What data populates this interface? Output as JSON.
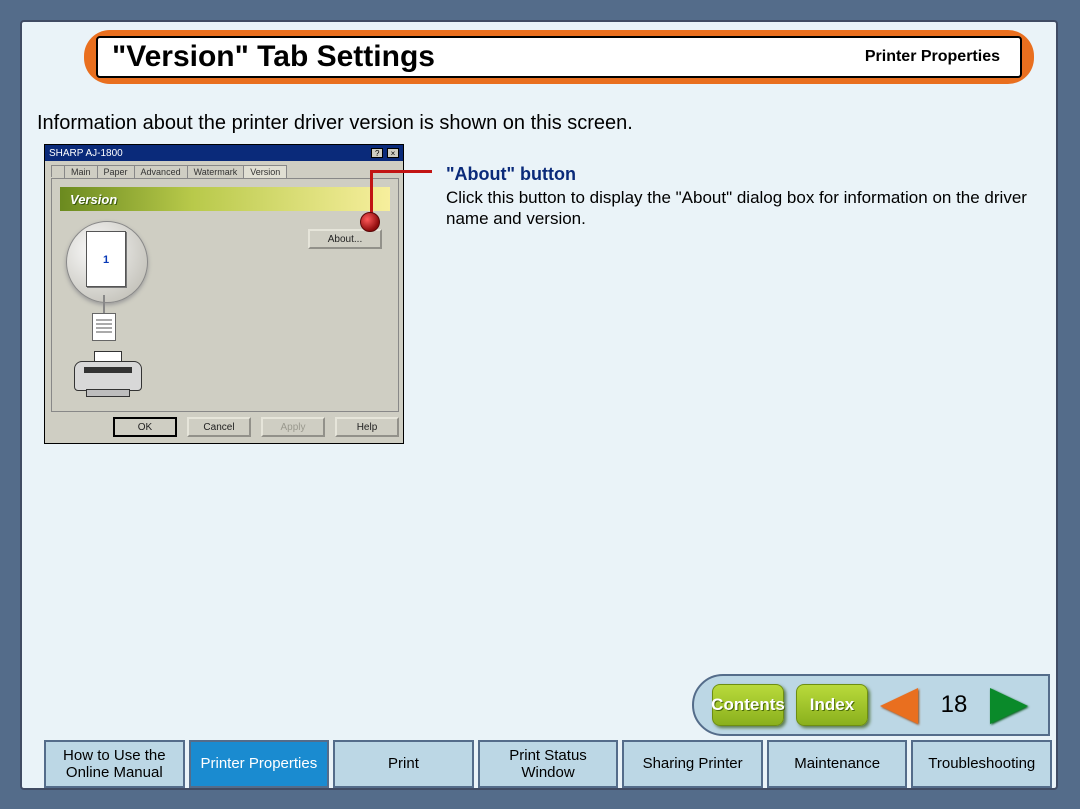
{
  "header": {
    "title": "\"Version\" Tab Settings",
    "section": "Printer Properties"
  },
  "intro": "Information about the printer driver version is shown on this screen.",
  "screenshot": {
    "window_title": "SHARP AJ-1800",
    "tabs": [
      "Main",
      "Paper",
      "Advanced",
      "Watermark",
      "Version"
    ],
    "active_tab": "Version",
    "panel_title": "Version",
    "about_button": "About...",
    "page_preview_number": "1",
    "buttons": {
      "ok": "OK",
      "cancel": "Cancel",
      "apply": "Apply",
      "help": "Help"
    }
  },
  "description": {
    "heading": "\"About\" button",
    "body": "Click this button to display the \"About\" dialog box for information on the driver name and version."
  },
  "navpill": {
    "contents": "Contents",
    "index": "Index",
    "page_number": "18"
  },
  "bottom_tabs": [
    "How to Use the\nOnline Manual",
    "Printer Properties",
    "Print",
    "Print Status\nWindow",
    "Sharing Printer",
    "Maintenance",
    "Troubleshooting"
  ],
  "bottom_active_index": 1
}
